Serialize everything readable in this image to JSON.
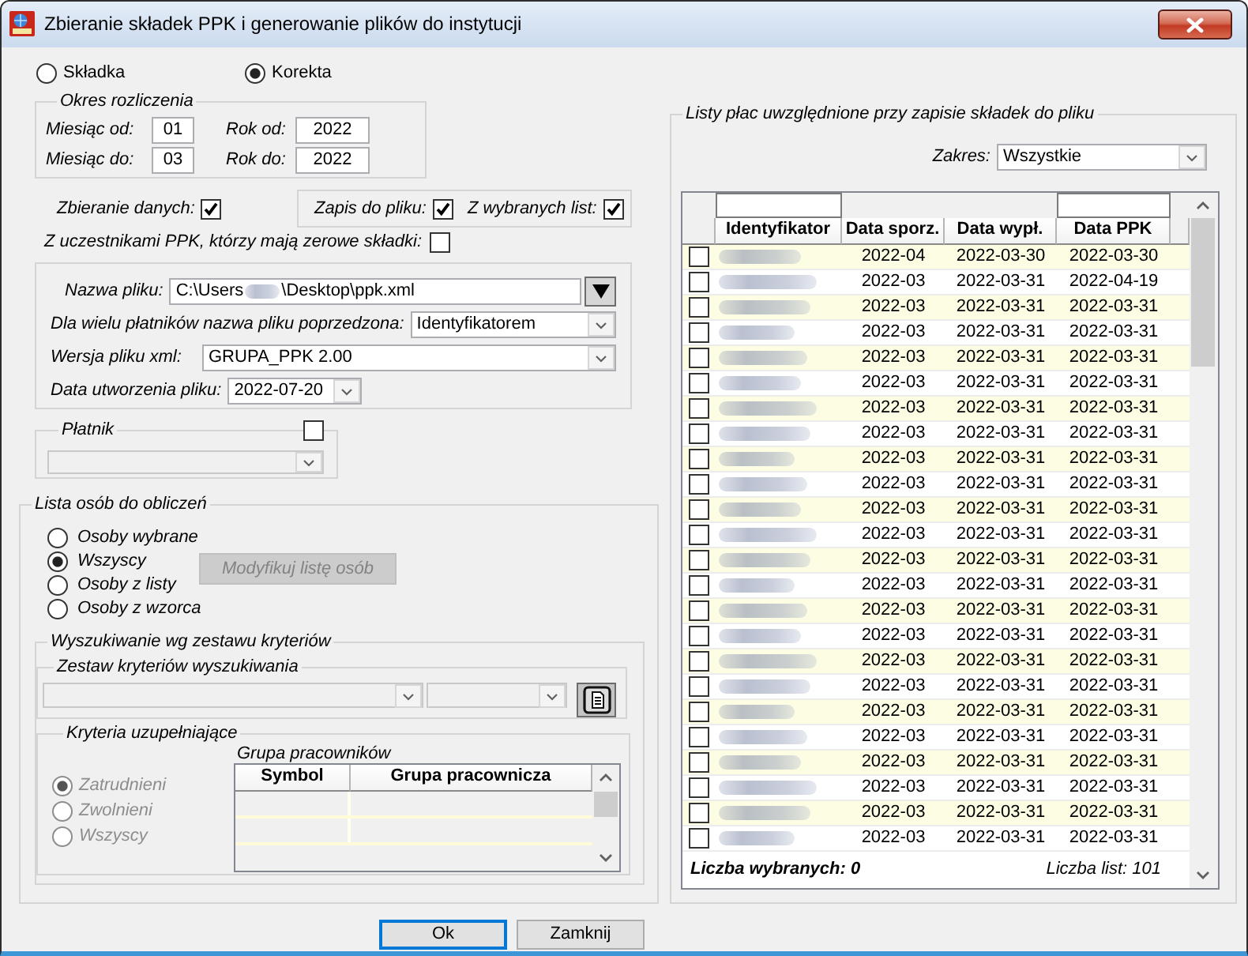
{
  "window": {
    "title": "Zbieranie składek PPK i generowanie plików do instytucji"
  },
  "mode_options": [
    {
      "label": "Składka",
      "selected": false
    },
    {
      "label": "Korekta",
      "selected": true
    }
  ],
  "period": {
    "title": "Okres rozliczenia",
    "rows": [
      {
        "month_label": "Miesiąc od:",
        "month": "01",
        "year_label": "Rok od:",
        "year": "2022"
      },
      {
        "month_label": "Miesiąc do:",
        "month": "03",
        "year_label": "Rok do:",
        "year": "2022"
      }
    ]
  },
  "data_collection": {
    "label": "Zbieranie danych:",
    "checked": true
  },
  "file_options": [
    {
      "label": "Zapis do pliku:",
      "checked": true
    },
    {
      "label": "Z wybranych list:",
      "checked": true
    }
  ],
  "zero_contributions": {
    "label": "Z uczestnikami PPK, którzy mają zerowe składki:",
    "checked": false
  },
  "file_settings": {
    "file_name": {
      "label": "Nazwa pliku:",
      "value_start": "C:\\Users",
      "value_end": "\\Desktop\\ppk.xml"
    },
    "prefix": {
      "label": "Dla wielu płatników nazwa pliku poprzedzona:",
      "value": "Identyfikatorem"
    },
    "xml_version": {
      "label": "Wersja pliku xml:",
      "value": "GRUPA_PPK 2.00"
    },
    "creation_date": {
      "label": "Data utworzenia pliku:",
      "value": "2022-07-20"
    }
  },
  "payer": {
    "title": "Płatnik",
    "checked": false,
    "disabled": true
  },
  "people_list": {
    "title": "Lista osób do obliczeń",
    "options": [
      {
        "label": "Osoby wybrane",
        "selected": false
      },
      {
        "label": "Wszyscy",
        "selected": true
      },
      {
        "label": "Osoby z listy",
        "selected": false
      },
      {
        "label": "Osoby z wzorca",
        "selected": false
      }
    ],
    "modify_button": {
      "label": "Modyfikuj listę osób",
      "disabled": true
    }
  },
  "search": {
    "title": "Wyszukiwanie wg zestawu kryteriów",
    "criteria_set": {
      "title": "Zestaw kryteriów wyszukiwania",
      "disabled": true
    },
    "supplementary": {
      "title": "Kryteria uzupełniające",
      "options": [
        {
          "label": "Zatrudnieni",
          "selected": true,
          "disabled": true
        },
        {
          "label": "Zwolnieni",
          "selected": false,
          "disabled": true
        },
        {
          "label": "Wszyscy",
          "selected": false,
          "disabled": true
        }
      ],
      "group_title": "Grupa pracowników",
      "columns": [
        "Symbol",
        "Grupa pracownicza"
      ]
    }
  },
  "payroll_lists": {
    "title": "Listy płac uwzględnione przy zapisie składek do pliku",
    "range": {
      "label": "Zakres:",
      "value": "Wszystkie"
    },
    "columns": [
      "Identyfikator",
      "Data sporz.",
      "Data wypł.",
      "Data PPK"
    ],
    "rows": [
      {
        "checked": false,
        "prepared": "2022-04",
        "paid": "2022-03-30",
        "ppk": "2022-03-30"
      },
      {
        "checked": false,
        "prepared": "2022-03",
        "paid": "2022-03-31",
        "ppk": "2022-04-19"
      },
      {
        "checked": false,
        "prepared": "2022-03",
        "paid": "2022-03-31",
        "ppk": "2022-03-31"
      },
      {
        "checked": false,
        "prepared": "2022-03",
        "paid": "2022-03-31",
        "ppk": "2022-03-31"
      },
      {
        "checked": false,
        "prepared": "2022-03",
        "paid": "2022-03-31",
        "ppk": "2022-03-31"
      },
      {
        "checked": false,
        "prepared": "2022-03",
        "paid": "2022-03-31",
        "ppk": "2022-03-31"
      },
      {
        "checked": false,
        "prepared": "2022-03",
        "paid": "2022-03-31",
        "ppk": "2022-03-31"
      },
      {
        "checked": false,
        "prepared": "2022-03",
        "paid": "2022-03-31",
        "ppk": "2022-03-31"
      },
      {
        "checked": false,
        "prepared": "2022-03",
        "paid": "2022-03-31",
        "ppk": "2022-03-31"
      },
      {
        "checked": false,
        "prepared": "2022-03",
        "paid": "2022-03-31",
        "ppk": "2022-03-31"
      },
      {
        "checked": false,
        "prepared": "2022-03",
        "paid": "2022-03-31",
        "ppk": "2022-03-31"
      },
      {
        "checked": false,
        "prepared": "2022-03",
        "paid": "2022-03-31",
        "ppk": "2022-03-31"
      },
      {
        "checked": false,
        "prepared": "2022-03",
        "paid": "2022-03-31",
        "ppk": "2022-03-31"
      },
      {
        "checked": false,
        "prepared": "2022-03",
        "paid": "2022-03-31",
        "ppk": "2022-03-31"
      },
      {
        "checked": false,
        "prepared": "2022-03",
        "paid": "2022-03-31",
        "ppk": "2022-03-31"
      },
      {
        "checked": false,
        "prepared": "2022-03",
        "paid": "2022-03-31",
        "ppk": "2022-03-31"
      },
      {
        "checked": false,
        "prepared": "2022-03",
        "paid": "2022-03-31",
        "ppk": "2022-03-31"
      },
      {
        "checked": false,
        "prepared": "2022-03",
        "paid": "2022-03-31",
        "ppk": "2022-03-31"
      },
      {
        "checked": false,
        "prepared": "2022-03",
        "paid": "2022-03-31",
        "ppk": "2022-03-31"
      },
      {
        "checked": false,
        "prepared": "2022-03",
        "paid": "2022-03-31",
        "ppk": "2022-03-31"
      },
      {
        "checked": false,
        "prepared": "2022-03",
        "paid": "2022-03-31",
        "ppk": "2022-03-31"
      },
      {
        "checked": false,
        "prepared": "2022-03",
        "paid": "2022-03-31",
        "ppk": "2022-03-31"
      },
      {
        "checked": false,
        "prepared": "2022-03",
        "paid": "2022-03-31",
        "ppk": "2022-03-31"
      },
      {
        "checked": false,
        "prepared": "2022-03",
        "paid": "2022-03-31",
        "ppk": "2022-03-31"
      }
    ],
    "selected_count": "Liczba wybranych: 0",
    "list_count": "Liczba list: 101"
  },
  "buttons": [
    {
      "label": "Ok",
      "focused": true
    },
    {
      "label": "Zamknij",
      "focused": false
    }
  ]
}
